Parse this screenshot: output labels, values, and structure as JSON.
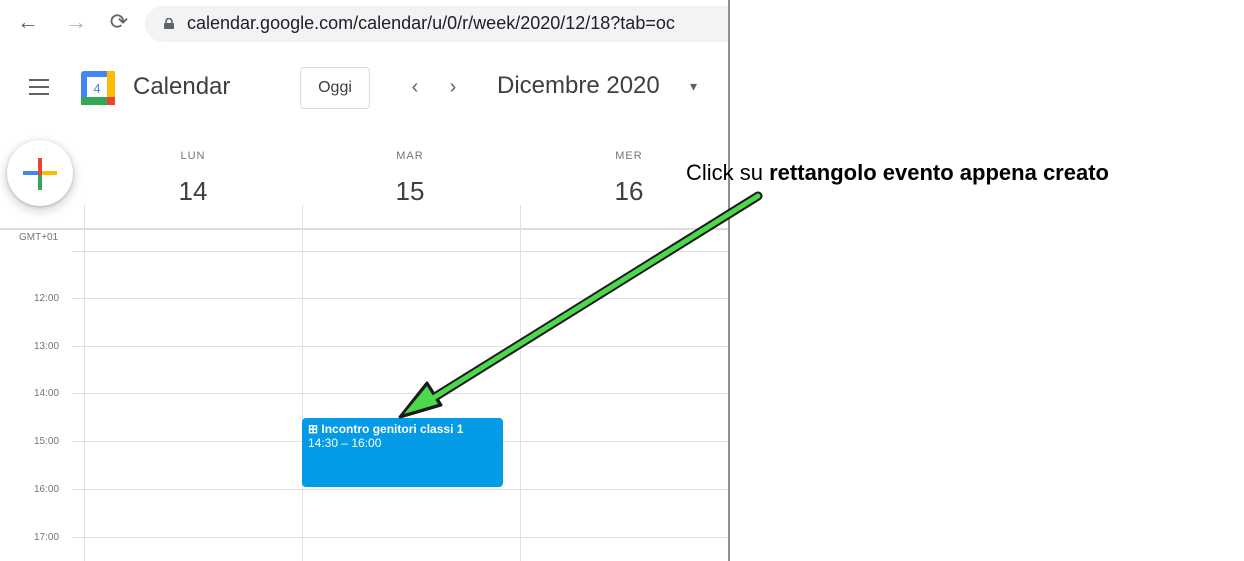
{
  "browser": {
    "url": "calendar.google.com/calendar/u/0/r/week/2020/12/18?tab=oc",
    "back_icon": "arrow-left-icon",
    "forward_icon": "arrow-right-icon",
    "reload_icon": "reload-icon",
    "lock_icon": "lock-icon"
  },
  "header": {
    "app_name": "Calendar",
    "logo_day": "4",
    "today_label": "Oggi",
    "prev_glyph": "‹",
    "next_glyph": "›",
    "month_label": "Dicembre 2020",
    "caret_glyph": "▾"
  },
  "days": [
    {
      "dow": "LUN",
      "num": "14"
    },
    {
      "dow": "MAR",
      "num": "15"
    },
    {
      "dow": "MER",
      "num": "16"
    }
  ],
  "timezone": "GMT+01",
  "hours": [
    "12:00",
    "13:00",
    "14:00",
    "15:00",
    "16:00",
    "17:00"
  ],
  "event": {
    "title": "⊞ Incontro genitori classi 1",
    "time": "14:30 – 16:00",
    "color": "#039be5"
  },
  "annotation": {
    "prefix": "Click su ",
    "bold": "rettangolo evento appena creato",
    "arrow_color": "#4cd84c"
  }
}
